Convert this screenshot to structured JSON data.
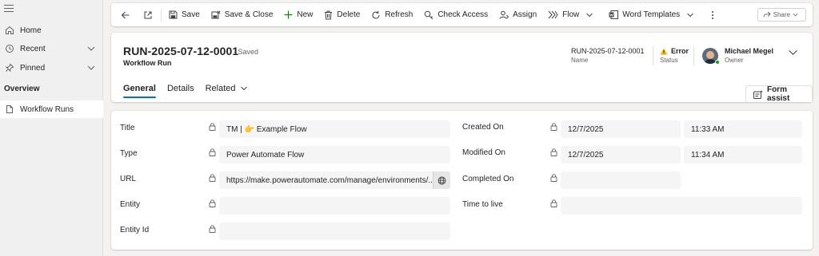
{
  "nav": {
    "items": [
      {
        "label": "Home"
      },
      {
        "label": "Recent"
      },
      {
        "label": "Pinned"
      }
    ],
    "section": "Overview",
    "entity_item": "Workflow Runs"
  },
  "toolbar": {
    "save": "Save",
    "save_close": "Save & Close",
    "new": "New",
    "delete": "Delete",
    "refresh": "Refresh",
    "check_access": "Check Access",
    "assign": "Assign",
    "flow": "Flow",
    "word_templates": "Word Templates",
    "share": "Share"
  },
  "header": {
    "title": "RUN-2025-07-12-0001",
    "saved_state": "- Saved",
    "entity": "Workflow Run",
    "name_value": "RUN-2025-07-12-0001",
    "name_label": "Name",
    "status_value": "Error",
    "status_label": "Status",
    "owner_value": "Michael Megel",
    "owner_label": "Owner"
  },
  "tabs": [
    {
      "label": "General"
    },
    {
      "label": "Details"
    },
    {
      "label": "Related"
    }
  ],
  "form_assist": "Form assist",
  "fields": {
    "title": {
      "label": "Title",
      "value": "TM | 👉 Example Flow"
    },
    "type": {
      "label": "Type",
      "value": "Power Automate Flow"
    },
    "url": {
      "label": "URL",
      "value": "https://make.powerautomate.com/manage/environments/..."
    },
    "entity": {
      "label": "Entity",
      "value": ""
    },
    "entity_id": {
      "label": "Entity Id",
      "value": ""
    },
    "created_on": {
      "label": "Created On",
      "date": "12/7/2025",
      "time": "11:33 AM"
    },
    "modified_on": {
      "label": "Modified On",
      "date": "12/7/2025",
      "time": "11:34 AM"
    },
    "completed_on": {
      "label": "Completed On",
      "date": ""
    },
    "time_to_live": {
      "label": "Time to live",
      "value": ""
    }
  },
  "colors": {
    "accent": "#0f6cbd",
    "owner_link": "#115ea3",
    "warning": "#f7b500",
    "presence": "#13a10e"
  }
}
